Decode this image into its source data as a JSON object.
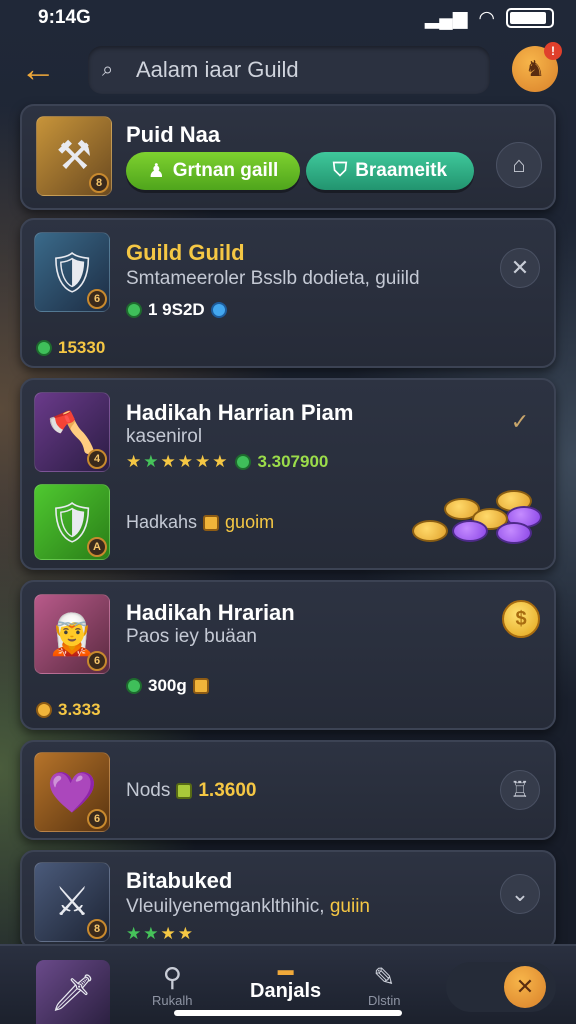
{
  "status_bar": {
    "time": "9:14G",
    "battery_level": 0.9
  },
  "header": {
    "search_placeholder": "Aalam iaar Guild"
  },
  "cards": [
    {
      "title": "Puid Naa",
      "buttons": [
        {
          "label": "Grtnan gaill"
        },
        {
          "label": "Braameitk"
        }
      ]
    },
    {
      "title": "Guild Guild",
      "subtitle": "Smtameeroler Bsslb dodieta, guiild",
      "stat": "1 9S2D",
      "score": "15330"
    },
    {
      "title": "Hadikah Harrian Piam",
      "subtitle": "kasenirol",
      "stars_value": "3.307900",
      "footer_label": "Hadkahs",
      "footer_value": "guoim"
    },
    {
      "title": "Hadikah Hrarian",
      "subtitle": "Paos iey buäan",
      "stat": "300g",
      "score": "3.333"
    },
    {
      "title": "",
      "label": "Nods",
      "value": "1.3600"
    },
    {
      "title": "Bitabuked",
      "subtitle_white": "Vleuilyenemganklthihic,",
      "subtitle_gold": "guiin"
    }
  ],
  "bottom_nav": {
    "item1": "Rukalh",
    "active": "Danjals",
    "item3": "Dlstin"
  },
  "colors": {
    "accent": "#f0a93a",
    "gold": "#f5c744",
    "green": "#4fa51c",
    "teal": "#22946f"
  }
}
